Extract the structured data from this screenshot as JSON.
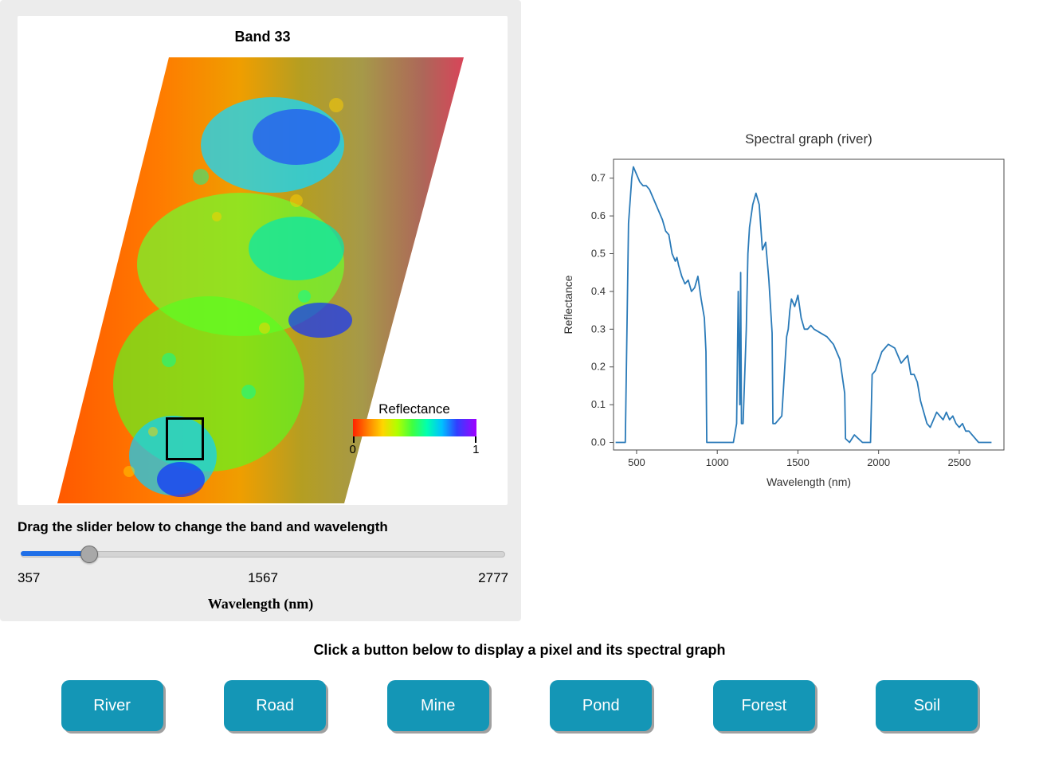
{
  "band": {
    "title": "Band 33",
    "colorbar": {
      "title": "Reflectance",
      "min_label": "0",
      "max_label": "1"
    }
  },
  "slider": {
    "label": "Drag the slider below to change the band and wavelength",
    "min": 357,
    "mid": 1567,
    "max": 2777,
    "value": 700,
    "axis_label": "Wavelength (nm)"
  },
  "buttons": {
    "caption": "Click a button below to display a pixel and its spectral graph",
    "items": [
      "River",
      "Road",
      "Mine",
      "Pond",
      "Forest",
      "Soil"
    ]
  },
  "chart_data": {
    "type": "line",
    "title": "Spectral graph (river)",
    "xlabel": "Wavelength (nm)",
    "ylabel": "Reflectance",
    "xlim": [
      357,
      2777
    ],
    "ylim": [
      -0.02,
      0.75
    ],
    "xticks": [
      500,
      1000,
      1500,
      2000,
      2500
    ],
    "yticks": [
      0.0,
      0.1,
      0.2,
      0.3,
      0.4,
      0.5,
      0.6,
      0.7
    ],
    "x": [
      370,
      430,
      450,
      470,
      480,
      500,
      520,
      540,
      560,
      580,
      600,
      620,
      640,
      660,
      680,
      700,
      720,
      740,
      750,
      760,
      780,
      800,
      820,
      840,
      860,
      880,
      900,
      920,
      930,
      935,
      960,
      1000,
      1030,
      1100,
      1120,
      1130,
      1140,
      1145,
      1150,
      1160,
      1180,
      1190,
      1200,
      1220,
      1240,
      1260,
      1280,
      1300,
      1320,
      1340,
      1345,
      1360,
      1380,
      1400,
      1430,
      1440,
      1450,
      1460,
      1480,
      1500,
      1520,
      1540,
      1560,
      1580,
      1600,
      1640,
      1680,
      1720,
      1760,
      1790,
      1795,
      1820,
      1850,
      1900,
      1950,
      1960,
      1980,
      2020,
      2060,
      2100,
      2140,
      2180,
      2200,
      2220,
      2240,
      2260,
      2280,
      2300,
      2320,
      2340,
      2360,
      2380,
      2400,
      2420,
      2440,
      2460,
      2480,
      2500,
      2520,
      2540,
      2560,
      2580,
      2620,
      2700
    ],
    "values": [
      0.0,
      0.0,
      0.58,
      0.7,
      0.73,
      0.71,
      0.69,
      0.68,
      0.68,
      0.67,
      0.65,
      0.63,
      0.61,
      0.59,
      0.56,
      0.55,
      0.5,
      0.48,
      0.49,
      0.47,
      0.44,
      0.42,
      0.43,
      0.4,
      0.41,
      0.44,
      0.38,
      0.33,
      0.24,
      0.0,
      0.0,
      0.0,
      0.0,
      0.0,
      0.05,
      0.4,
      0.1,
      0.45,
      0.05,
      0.05,
      0.3,
      0.5,
      0.57,
      0.63,
      0.66,
      0.63,
      0.51,
      0.53,
      0.43,
      0.29,
      0.05,
      0.05,
      0.06,
      0.07,
      0.28,
      0.3,
      0.35,
      0.38,
      0.36,
      0.39,
      0.33,
      0.3,
      0.3,
      0.31,
      0.3,
      0.29,
      0.28,
      0.26,
      0.22,
      0.13,
      0.01,
      0.0,
      0.02,
      0.0,
      0.0,
      0.18,
      0.19,
      0.24,
      0.26,
      0.25,
      0.21,
      0.23,
      0.18,
      0.18,
      0.16,
      0.11,
      0.08,
      0.05,
      0.04,
      0.06,
      0.08,
      0.07,
      0.06,
      0.08,
      0.06,
      0.07,
      0.05,
      0.04,
      0.05,
      0.03,
      0.03,
      0.02,
      0.0,
      0.0
    ]
  }
}
